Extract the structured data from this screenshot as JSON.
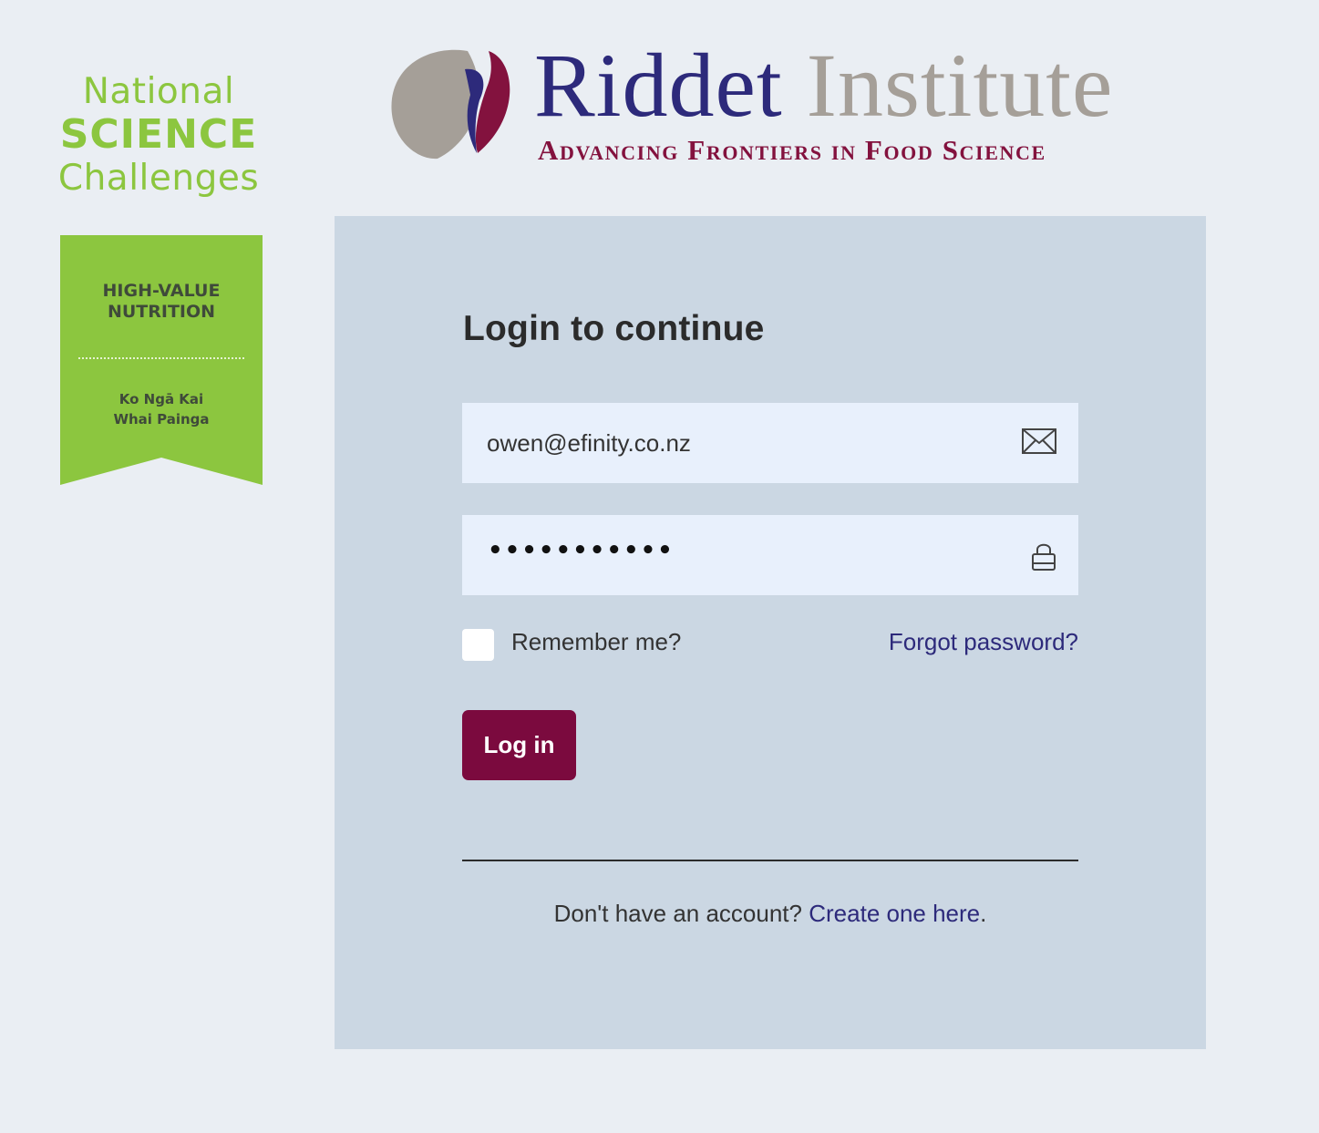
{
  "nsc_logo": {
    "line1": "National",
    "line2": "SCIENCE",
    "line3": "Challenges",
    "color": "#8cc63f"
  },
  "badge": {
    "title_line1": "HIGH-VALUE",
    "title_line2": "NUTRITION",
    "subtitle_line1": "Ko Ngā Kai",
    "subtitle_line2": "Whai Painga",
    "color": "#8cc63f"
  },
  "riddet": {
    "name_part1": "Riddet",
    "name_part2": "Institute",
    "tagline": "Advancing Frontiers in Food Science",
    "colors": {
      "navy": "#2d2a7b",
      "taupe": "#a59f98",
      "maroon": "#83123e"
    }
  },
  "login": {
    "title": "Login to continue",
    "email": {
      "value": "owen@efinity.co.nz",
      "icon": "envelope-icon"
    },
    "password": {
      "masked_value": "•••••••••••",
      "icon": "lock-icon"
    },
    "remember_label": "Remember me?",
    "remember_checked": false,
    "forgot_label": "Forgot password?",
    "submit_label": "Log in",
    "signup_prompt": "Don't have an account?",
    "signup_link": "Create one here",
    "signup_suffix": "."
  },
  "colors": {
    "page_bg": "#eaeef3",
    "panel_bg": "#cbd7e3",
    "input_bg": "#e8f0fc",
    "button_bg": "#7b0a3e",
    "link": "#2d2a7b"
  }
}
